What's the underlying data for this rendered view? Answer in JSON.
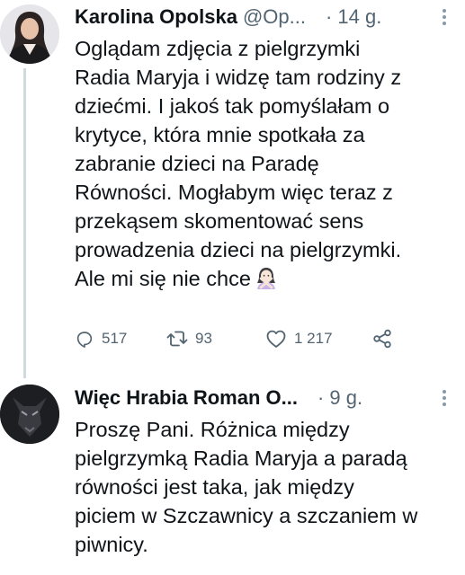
{
  "tweets": [
    {
      "author_name": "Karolina Opolska",
      "handle": "@Op...",
      "time": "· 14 g.",
      "lines": [
        "Oglądam zdjęcia z pielgrzymki",
        "Radia Maryja i widzę tam rodziny z",
        "dziećmi. I jakoś tak pomyślałam o",
        "krytyce, która mnie spotkała za",
        "zabranie dzieci na Paradę",
        "Równości. Mogłabym więc teraz z",
        "przekąsem skomentować sens",
        "prowadzenia dzieci na pielgrzymki.",
        "Ale mi się nie chce"
      ],
      "emoji": "woman-gesturing-no-icon",
      "actions": {
        "replies": "517",
        "retweets": "93",
        "likes": "1 217"
      }
    },
    {
      "author_name": "Więc Hrabia Roman O...",
      "time": "· 9 g.",
      "lines": [
        "Proszę Pani. Różnica między",
        "pielgrzymką Radia Maryja a paradą",
        "równości jest taka, jak między",
        "piciem w Szczawnicy a szczaniem w",
        "piwnicy."
      ]
    }
  ],
  "colors": {
    "text": "#0f1419",
    "muted": "#536471",
    "thread_line": "#cfd9de"
  }
}
